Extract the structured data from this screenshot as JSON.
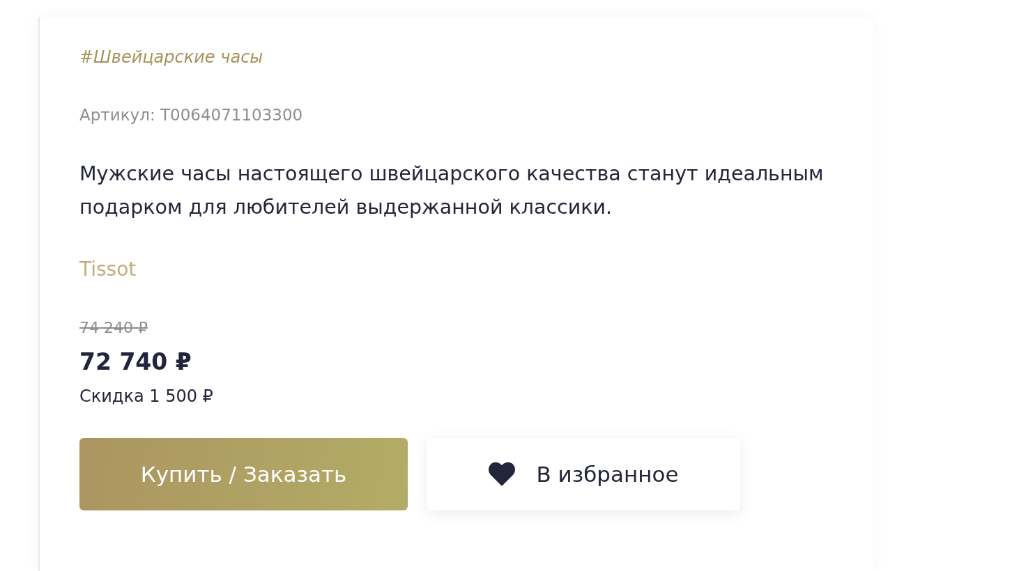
{
  "product": {
    "tag": "#Швейцарские часы",
    "sku": "Артикул: T0064071103300",
    "description": "Мужские часы настоящего швейцарского качества станут идеальным подарком для любителей выдержанной классики.",
    "brand": "Tissot",
    "price": {
      "old": "74 240 ₽",
      "current": "72 740 ₽",
      "discount": "Скидка 1 500 ₽"
    },
    "buttons": [
      {
        "kind": "buy",
        "label": "Купить / Заказать"
      },
      {
        "kind": "favorite",
        "label": "В избранное"
      }
    ]
  }
}
